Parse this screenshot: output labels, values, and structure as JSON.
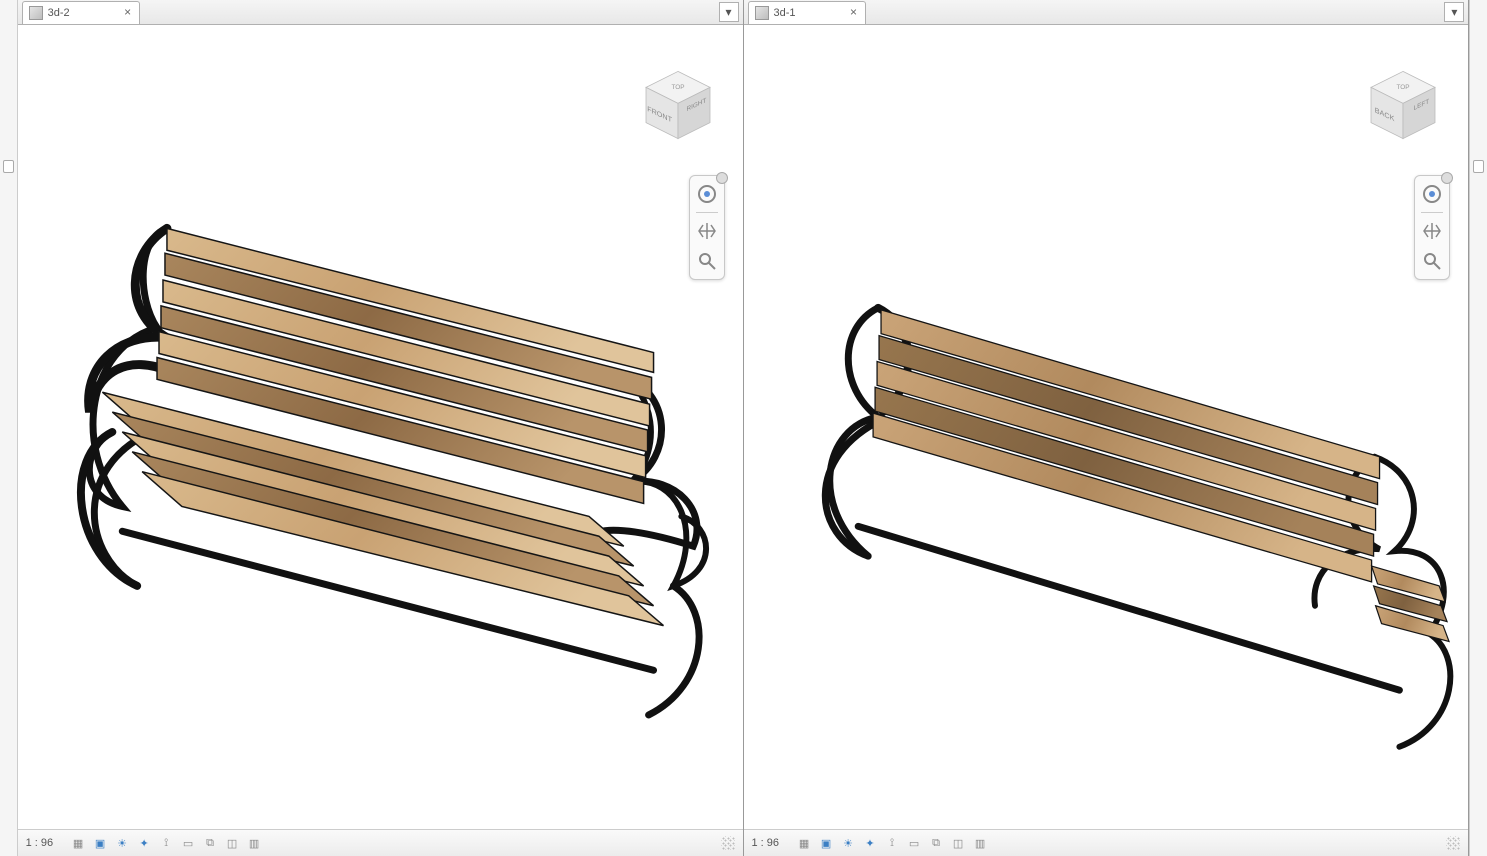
{
  "panes": [
    {
      "tab_label": "3d-2",
      "close_glyph": "×",
      "menu_glyph": "▾",
      "viewcube": {
        "top": "TOP",
        "front": "FRONT",
        "side": "RIGHT"
      },
      "status": {
        "scale": "1 : 96",
        "icons": [
          "detail-level",
          "model-graphics",
          "shadows",
          "sun-path",
          "rendering",
          "crop-view",
          "crop-region",
          "hide-isolate",
          "reveal"
        ]
      }
    },
    {
      "tab_label": "3d-1",
      "close_glyph": "×",
      "menu_glyph": "▾",
      "viewcube": {
        "top": "TOP",
        "front": "BACK",
        "side": "LEFT"
      },
      "status": {
        "scale": "1 : 96",
        "icons": [
          "detail-level",
          "model-graphics",
          "shadows",
          "sun-path",
          "rendering",
          "crop-view",
          "crop-region",
          "hide-isolate",
          "reveal"
        ]
      }
    }
  ],
  "navbar_items": [
    "steering-wheel",
    "pan",
    "zoom"
  ],
  "colors": {
    "wood_light": "#d9b98c",
    "wood_mid": "#c9a273",
    "wood_dark": "#9f7d55",
    "metal": "#111111"
  }
}
